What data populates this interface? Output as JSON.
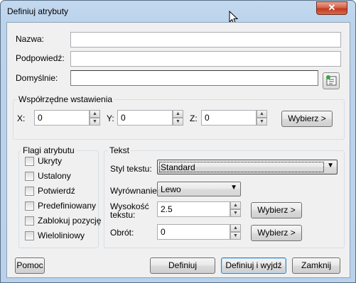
{
  "window": {
    "title": "Definiuj atrybuty",
    "close_glyph": "✕"
  },
  "fields": {
    "nazwa": {
      "label": "Nazwa:",
      "value": ""
    },
    "podpowiedz": {
      "label": "Podpowiedź:",
      "value": ""
    },
    "domyslnie": {
      "label": "Domyślnie:",
      "value": ""
    }
  },
  "insertion": {
    "title": "Współrzędne wstawienia",
    "x": {
      "label": "X:",
      "value": "0"
    },
    "y": {
      "label": "Y:",
      "value": "0"
    },
    "z": {
      "label": "Z:",
      "value": "0"
    },
    "pick_label": "Wybierz >"
  },
  "flags": {
    "title": "Flagi atrybutu",
    "items": [
      {
        "label": "Ukryty",
        "checked": false
      },
      {
        "label": "Ustalony",
        "checked": false
      },
      {
        "label": "Potwierdź",
        "checked": false
      },
      {
        "label": "Predefiniowany",
        "checked": false
      },
      {
        "label": "Zablokuj pozycję",
        "checked": false
      },
      {
        "label": "Wieloliniowy",
        "checked": false
      }
    ]
  },
  "text": {
    "title": "Tekst",
    "style": {
      "label": "Styl tekstu:",
      "value": "Standard"
    },
    "align": {
      "label": "Wyrównanie:",
      "value": "Lewo"
    },
    "height": {
      "label_line1": "Wysokość",
      "label_line2": "tekstu:",
      "value": "2.5",
      "pick_label": "Wybierz >"
    },
    "rotation": {
      "label": "Obrót:",
      "value": "0",
      "pick_label": "Wybierz >"
    }
  },
  "footer": {
    "help": "Pomoc",
    "define": "Definiuj",
    "define_exit": "Definiuj i wyjdź",
    "close": "Zamknij"
  },
  "icons": {
    "up_arrow": "▲",
    "down_arrow": "▼",
    "dropdown": "▼"
  }
}
